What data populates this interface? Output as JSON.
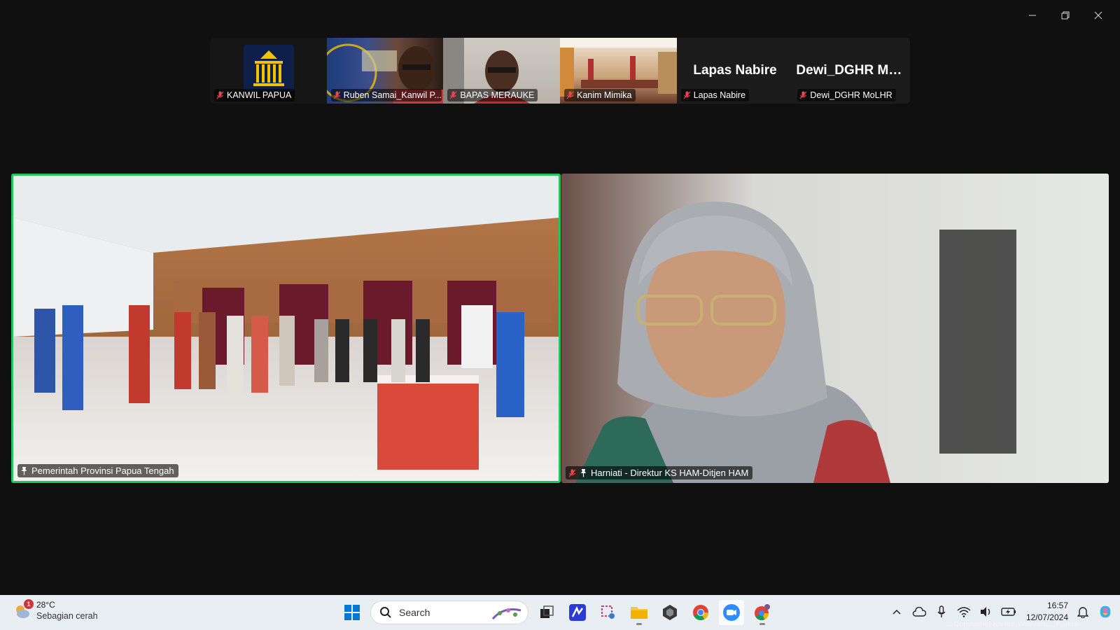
{
  "window": {
    "controls": [
      "minimize",
      "restore",
      "close"
    ]
  },
  "participants": [
    {
      "name": "KANWIL PAPUA",
      "type": "logo"
    },
    {
      "name": "Ruben Samai_Kanwil P...",
      "type": "video"
    },
    {
      "name": "BAPAS MERAUKE",
      "type": "video"
    },
    {
      "name": "Kanim Mimika",
      "type": "video"
    },
    {
      "name": "Lapas Nabire",
      "type": "name",
      "display": "Lapas Nabire"
    },
    {
      "name": "Dewi_DGHR MoLHR",
      "type": "name",
      "display": "Dewi_DGHR Mo..."
    }
  ],
  "main": {
    "left_label": "Pemerintah Provinsi Papua Tengah",
    "right_label": "Harniati - Direktur KS HAM-Ditjen HAM"
  },
  "colors": {
    "active_speaker_border": "#22c55e",
    "mic_muted": "#e5484d"
  },
  "taskbar": {
    "weather": {
      "temp": "28°C",
      "condition": "Sebagian cerah",
      "badge": "1"
    },
    "search_label": "Search",
    "time": "16:57",
    "date": "12/07/2024",
    "watermark": "© Copyright | Kantor Wilayah ... Papua"
  }
}
